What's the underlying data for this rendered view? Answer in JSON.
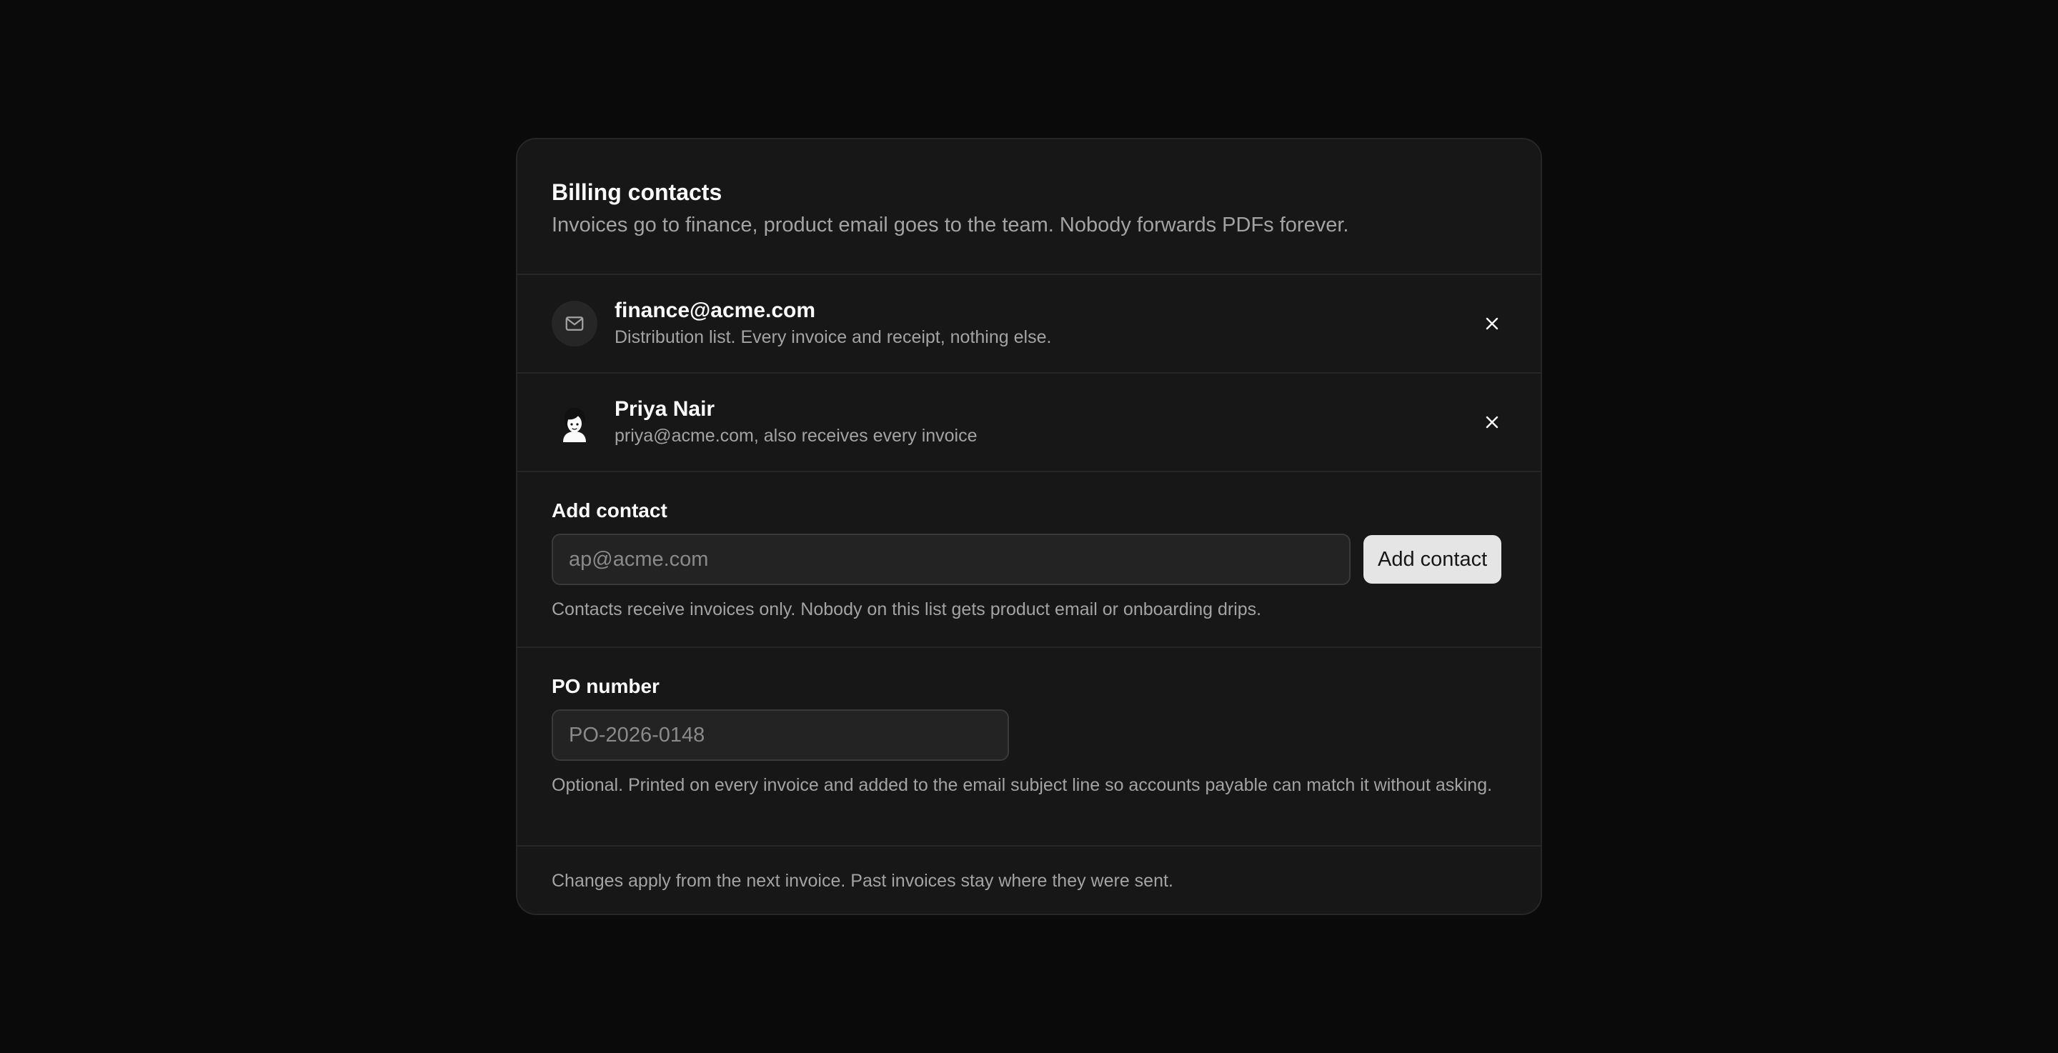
{
  "card": {
    "title": "Billing contacts",
    "subtitle": "Invoices go to finance, product email goes to the team. Nobody forwards PDFs forever."
  },
  "contacts": [
    {
      "name": "finance@acme.com",
      "description": "Distribution list. Every invoice and receipt, nothing else.",
      "icon": "mail-icon",
      "remove_icon": "close-icon"
    },
    {
      "name": "Priya Nair",
      "description": "priya@acme.com, also receives every invoice",
      "icon": "avatar",
      "remove_icon": "close-icon"
    }
  ],
  "add_contact": {
    "label": "Add contact",
    "input_placeholder": "ap@acme.com",
    "input_value": "",
    "button_label": "Add contact",
    "helper": "Contacts receive invoices only. Nobody on this list gets product email or onboarding drips."
  },
  "po_number": {
    "label": "PO number",
    "input_placeholder": "PO-2026-0148",
    "input_value": "",
    "helper": "Optional. Printed on every invoice and added to the email subject line so accounts payable can match it without asking."
  },
  "footer": {
    "text": "Changes apply from the next invoice. Past invoices stay where they were sent."
  },
  "colors": {
    "background": "#0a0a0a",
    "card": "#171717",
    "border": "#262626",
    "text_primary": "#fafafa",
    "text_muted": "#a3a3a3",
    "button_bg": "#e5e5e5"
  }
}
